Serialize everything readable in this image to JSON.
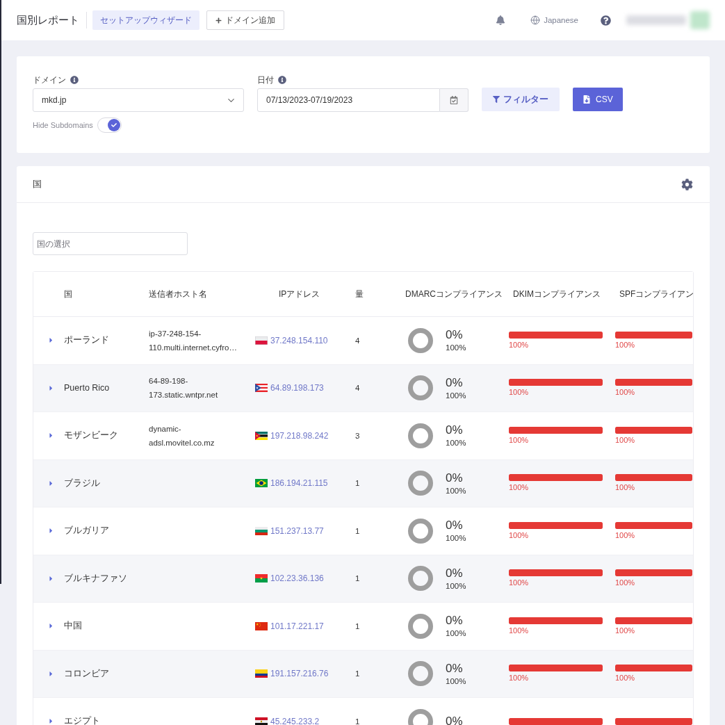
{
  "header": {
    "title": "国別レポート",
    "buttons": [
      {
        "kind": "wizard",
        "label": "セットアップウィザード"
      },
      {
        "kind": "add",
        "label": "ドメイン追加"
      }
    ],
    "language": "Japanese"
  },
  "filters": {
    "domain": {
      "label": "ドメイン",
      "value": "mkd.jp"
    },
    "date": {
      "label": "日付",
      "value": "07/13/2023-07/19/2023"
    },
    "filter_button": "フィルター",
    "csv_button": "CSV",
    "hide_subdomains": {
      "label": "Hide Subdomains",
      "on": true
    }
  },
  "countries": {
    "title": "国",
    "search": {
      "placeholder": "国の選択"
    },
    "table": {
      "columns": [
        "国",
        "送信者ホスト名",
        "IPアドレス",
        "量",
        "DMARCコンプライアンス",
        "DKIMコンプライアンス",
        "SPFコンプライアン"
      ],
      "rows": [
        {
          "country": "ポーランド",
          "flag": {
            "kind": "pl"
          },
          "hostname": "ip-37-248-154-110.multi.internet.cyfro…",
          "ip": "37.248.154.110",
          "volume": "4",
          "dmarc": {
            "percent": "0%",
            "total": "100%"
          },
          "dkim": {
            "level": 1,
            "label": "100%"
          },
          "spf": {
            "level": 1,
            "label": "100%"
          },
          "expanded": false
        },
        {
          "country": "Puerto Rico",
          "flag": {
            "kind": "pr"
          },
          "hostname": "64-89-198-173.static.wntpr.net",
          "ip": "64.89.198.173",
          "volume": "4",
          "dmarc": {
            "percent": "0%",
            "total": "100%"
          },
          "dkim": {
            "level": 1,
            "label": "100%"
          },
          "spf": {
            "level": 1,
            "label": "100%"
          },
          "expanded": false
        },
        {
          "country": "モザンビーク",
          "flag": {
            "kind": "mz"
          },
          "hostname": "dynamic-adsl.movitel.co.mz",
          "ip": "197.218.98.242",
          "volume": "3",
          "dmarc": {
            "percent": "0%",
            "total": "100%"
          },
          "dkim": {
            "level": 1,
            "label": "100%"
          },
          "spf": {
            "level": 1,
            "label": "100%"
          },
          "expanded": false
        },
        {
          "country": "ブラジル",
          "flag": {
            "kind": "br"
          },
          "ip": "186.194.21.115",
          "volume": "1",
          "dmarc": {
            "percent": "0%",
            "total": "100%"
          },
          "dkim": {
            "level": 1,
            "label": "100%"
          },
          "spf": {
            "level": 1,
            "label": "100%"
          },
          "expanded": false
        },
        {
          "country": "ブルガリア",
          "flag": {
            "kind": "bg"
          },
          "ip": "151.237.13.77",
          "volume": "1",
          "dmarc": {
            "percent": "0%",
            "total": "100%"
          },
          "dkim": {
            "level": 1,
            "label": "100%"
          },
          "spf": {
            "level": 1,
            "label": "100%"
          },
          "expanded": false
        },
        {
          "country": "ブルキナファソ",
          "flag": {
            "kind": "bf"
          },
          "ip": "102.23.36.136",
          "volume": "1",
          "dmarc": {
            "percent": "0%",
            "total": "100%"
          },
          "dkim": {
            "level": 1,
            "label": "100%"
          },
          "spf": {
            "level": 1,
            "label": "100%"
          },
          "expanded": false
        },
        {
          "country": "中国",
          "flag": {
            "kind": "cn"
          },
          "ip": "101.17.221.17",
          "volume": "1",
          "dmarc": {
            "percent": "0%",
            "total": "100%"
          },
          "dkim": {
            "level": 1,
            "label": "100%"
          },
          "spf": {
            "level": 1,
            "label": "100%"
          },
          "expanded": false
        },
        {
          "country": "コロンビア",
          "flag": {
            "kind": "co"
          },
          "ip": "191.157.216.76",
          "volume": "1",
          "dmarc": {
            "percent": "0%",
            "total": "100%"
          },
          "dkim": {
            "level": 1,
            "label": "100%"
          },
          "spf": {
            "level": 1,
            "label": "100%"
          },
          "expanded": false
        },
        {
          "country": "エジプト",
          "flag": {
            "kind": "eg"
          },
          "ip": "45.245.233.2",
          "volume": "1",
          "dmarc": {
            "percent": "0%"
          },
          "dkim": {
            "level": 1
          },
          "spf": {
            "level": 1
          },
          "expanded": false
        }
      ]
    }
  }
}
